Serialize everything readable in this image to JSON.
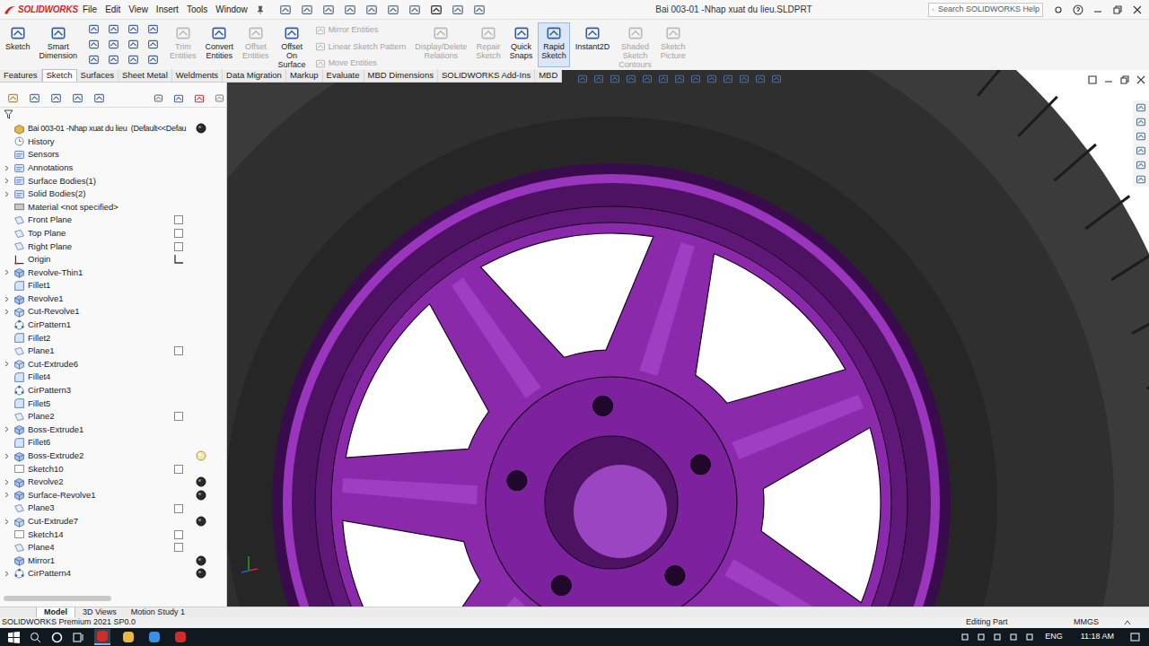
{
  "window": {
    "title": "Bai 003-01 -Nhap xuat du lieu.SLDPRT",
    "logo": "SOLIDWORKS"
  },
  "menus": [
    "File",
    "Edit",
    "View",
    "Insert",
    "Tools",
    "Window"
  ],
  "search": {
    "placeholder": "Search SOLIDWORKS Help"
  },
  "command_manager": [
    {
      "kind": "large",
      "label": [
        "Sketch"
      ],
      "disabled": false,
      "selected": false,
      "entries": []
    },
    {
      "kind": "large",
      "label": [
        "Smart",
        "Dimension"
      ],
      "disabled": false,
      "selected": false,
      "entries": []
    },
    {
      "kind": "grid",
      "label": [],
      "disabled": false,
      "selected": false,
      "entries": []
    },
    {
      "kind": "large",
      "label": [
        "Trim",
        "Entities"
      ],
      "disabled": true,
      "selected": false,
      "entries": []
    },
    {
      "kind": "large",
      "label": [
        "Convert",
        "Entities"
      ],
      "disabled": false,
      "selected": false,
      "entries": []
    },
    {
      "kind": "large",
      "label": [
        "Offset",
        "Entities"
      ],
      "disabled": true,
      "selected": false,
      "entries": []
    },
    {
      "kind": "large",
      "label": [
        "Offset",
        "On",
        "Surface"
      ],
      "disabled": false,
      "selected": false,
      "entries": []
    },
    {
      "kind": "stack",
      "label": [],
      "disabled": false,
      "selected": false,
      "entries": [
        {
          "label": "Mirror Entities",
          "disabled": true
        },
        {
          "label": "Linear Sketch Pattern",
          "disabled": true
        },
        {
          "label": "Move Entities",
          "disabled": true
        }
      ]
    },
    {
      "kind": "large",
      "label": [
        "Display/Delete",
        "Relations"
      ],
      "disabled": true,
      "selected": false,
      "entries": []
    },
    {
      "kind": "large",
      "label": [
        "Repair",
        "Sketch"
      ],
      "disabled": true,
      "selected": false,
      "entries": []
    },
    {
      "kind": "large",
      "label": [
        "Quick",
        "Snaps"
      ],
      "disabled": false,
      "selected": false,
      "entries": []
    },
    {
      "kind": "large",
      "label": [
        "Rapid",
        "Sketch"
      ],
      "disabled": false,
      "selected": true,
      "entries": []
    },
    {
      "kind": "large",
      "label": [
        "Instant2D"
      ],
      "disabled": false,
      "selected": false,
      "entries": []
    },
    {
      "kind": "large",
      "label": [
        "Shaded",
        "Sketch",
        "Contours"
      ],
      "disabled": true,
      "selected": false,
      "entries": []
    },
    {
      "kind": "large",
      "label": [
        "Sketch",
        "Picture"
      ],
      "disabled": true,
      "selected": false,
      "entries": []
    }
  ],
  "tabs": [
    {
      "label": "Features",
      "selected": false
    },
    {
      "label": "Sketch",
      "selected": true
    },
    {
      "label": "Surfaces",
      "selected": false
    },
    {
      "label": "Sheet Metal",
      "selected": false
    },
    {
      "label": "Weldments",
      "selected": false
    },
    {
      "label": "Data Migration",
      "selected": false
    },
    {
      "label": "Markup",
      "selected": false
    },
    {
      "label": "Evaluate",
      "selected": false
    },
    {
      "label": "MBD Dimensions",
      "selected": false
    },
    {
      "label": "SOLIDWORKS Add-Ins",
      "selected": false
    },
    {
      "label": "MBD",
      "selected": false
    }
  ],
  "tree": [
    {
      "label": "Bai 003-01 -Nhap xuat du lieu  (Default<<Defau",
      "kind": "part",
      "expandable": false,
      "marker": "ball"
    },
    {
      "label": "History",
      "kind": "history",
      "expandable": false,
      "marker": "none"
    },
    {
      "label": "Sensors",
      "kind": "sensor",
      "expandable": false,
      "marker": "none"
    },
    {
      "label": "Annotations",
      "kind": "annotation",
      "expandable": true,
      "marker": "none"
    },
    {
      "label": "Surface Bodies(1)",
      "kind": "bodies",
      "expandable": true,
      "marker": "none"
    },
    {
      "label": "Solid Bodies(2)",
      "kind": "bodies",
      "expandable": true,
      "marker": "none"
    },
    {
      "label": "Material <not specified>",
      "kind": "material",
      "expandable": false,
      "marker": "none"
    },
    {
      "label": "Front Plane",
      "kind": "plane",
      "expandable": false,
      "marker": "plane"
    },
    {
      "label": "Top Plane",
      "kind": "plane",
      "expandable": false,
      "marker": "plane"
    },
    {
      "label": "Right Plane",
      "kind": "plane",
      "expandable": false,
      "marker": "plane"
    },
    {
      "label": "Origin",
      "kind": "origin",
      "expandable": false,
      "marker": "origin"
    },
    {
      "label": "Revolve-Thin1",
      "kind": "revolve",
      "expandable": true,
      "marker": "none"
    },
    {
      "label": "Fillet1",
      "kind": "fillet",
      "expandable": false,
      "marker": "none"
    },
    {
      "label": "Revolve1",
      "kind": "revolve",
      "expandable": true,
      "marker": "none"
    },
    {
      "label": "Cut-Revolve1",
      "kind": "cut",
      "expandable": true,
      "marker": "none"
    },
    {
      "label": "CirPattern1",
      "kind": "pattern",
      "expandable": false,
      "marker": "none"
    },
    {
      "label": "Fillet2",
      "kind": "fillet",
      "expandable": false,
      "marker": "none"
    },
    {
      "label": "Plane1",
      "kind": "plane",
      "expandable": false,
      "marker": "plane"
    },
    {
      "label": "Cut-Extrude6",
      "kind": "cut",
      "expandable": true,
      "marker": "none"
    },
    {
      "label": "Fillet4",
      "kind": "fillet",
      "expandable": false,
      "marker": "none"
    },
    {
      "label": "CirPattern3",
      "kind": "pattern",
      "expandable": false,
      "marker": "none"
    },
    {
      "label": "Fillet5",
      "kind": "fillet",
      "expandable": false,
      "marker": "none"
    },
    {
      "label": "Plane2",
      "kind": "plane",
      "expandable": false,
      "marker": "plane"
    },
    {
      "label": "Boss-Extrude1",
      "kind": "extrude",
      "expandable": true,
      "marker": "none"
    },
    {
      "label": "Fillet6",
      "kind": "fillet",
      "expandable": false,
      "marker": "none"
    },
    {
      "label": "Boss-Extrude2",
      "kind": "extrude",
      "expandable": true,
      "marker": "ball-lit"
    },
    {
      "label": "Sketch10",
      "kind": "sketch",
      "expandable": false,
      "marker": "sketch"
    },
    {
      "label": "Revolve2",
      "kind": "revolve",
      "expandable": true,
      "marker": "ball"
    },
    {
      "label": "Surface-Revolve1",
      "kind": "surface",
      "expandable": true,
      "marker": "ball"
    },
    {
      "label": "Plane3",
      "kind": "plane",
      "expandable": false,
      "marker": "plane"
    },
    {
      "label": "Cut-Extrude7",
      "kind": "cut",
      "expandable": true,
      "marker": "ball"
    },
    {
      "label": "Sketch14",
      "kind": "sketch",
      "expandable": false,
      "marker": "sketch"
    },
    {
      "label": "Plane4",
      "kind": "plane",
      "expandable": false,
      "marker": "plane"
    },
    {
      "label": "Mirror1",
      "kind": "mirror",
      "expandable": false,
      "marker": "ball"
    },
    {
      "label": "CirPattern4",
      "kind": "pattern",
      "expandable": true,
      "marker": "ball"
    }
  ],
  "bottom_tabs": [
    {
      "label": "Model",
      "selected": true
    },
    {
      "label": "3D Views",
      "selected": false
    },
    {
      "label": "Motion Study 1",
      "selected": false
    }
  ],
  "status_bar": {
    "product": "SOLIDWORKS Premium 2021 SP0.0",
    "mode": "Editing Part",
    "units": "MMGS"
  },
  "taskbar": {
    "language": "ENG",
    "time": "11:18 AM"
  }
}
